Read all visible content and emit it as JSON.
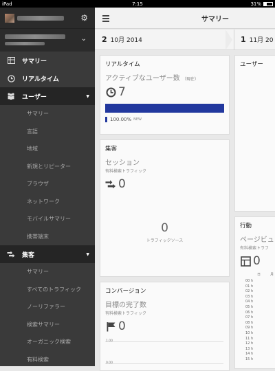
{
  "status": {
    "device": "iPad",
    "time": "7:15",
    "battery": "31%"
  },
  "header": {
    "title": "サマリー"
  },
  "dates": {
    "left_day": "2",
    "left_rest": "10月 2014",
    "right_day": "1",
    "right_rest": "11月 20"
  },
  "sidebar": {
    "main_items": [
      {
        "label": "サマリー",
        "icon": "grid-icon"
      },
      {
        "label": "リアルタイム",
        "icon": "clock-icon"
      },
      {
        "label": "ユーザー",
        "icon": "users-icon"
      }
    ],
    "users_sub": [
      "サマリー",
      "言語",
      "地域",
      "新規とリピーター",
      "ブラウザ",
      "ネットワーク",
      "モバイルサマリー",
      "携帯端末"
    ],
    "acquisition": {
      "label": "集客",
      "icon": "acquisition-icon"
    },
    "acq_sub": [
      "サマリー",
      "すべてのトラフィック",
      "ノーリファラー",
      "検索サマリー",
      "オーガニック検索",
      "有料検索"
    ]
  },
  "realtime": {
    "title": "リアルタイム",
    "subtitle": "アクティブなユーザー数",
    "note": "（現在）",
    "value": "7",
    "pct": "100.00%",
    "new_label": "NEW",
    "new_share": 1.0
  },
  "users_card": {
    "title": "ユーザー"
  },
  "acquisition_card": {
    "title": "集客",
    "subtitle": "セッション",
    "sub2": "有料検索トラフィック",
    "value": "0",
    "center_value": "0",
    "center_label": "トラフィックソース"
  },
  "behavior_card": {
    "title": "行動",
    "subtitle": "ページビュ",
    "sub2": "有料検索トラフ",
    "value": "0",
    "col_label": "日",
    "col_label2": "月",
    "hours": [
      "00 h",
      "01 h",
      "02 h",
      "03 h",
      "04 h",
      "05 h",
      "06 h",
      "07 h",
      "08 h",
      "09 h",
      "10 h",
      "11 h",
      "12 h",
      "13 h",
      "14 h",
      "15 h"
    ]
  },
  "conversion_card": {
    "title": "コンバージョン",
    "subtitle": "目標の完了数",
    "sub2": "有料検索トラフィック",
    "value": "0",
    "tick_top": "1.00",
    "tick_bottom": "0.00"
  }
}
